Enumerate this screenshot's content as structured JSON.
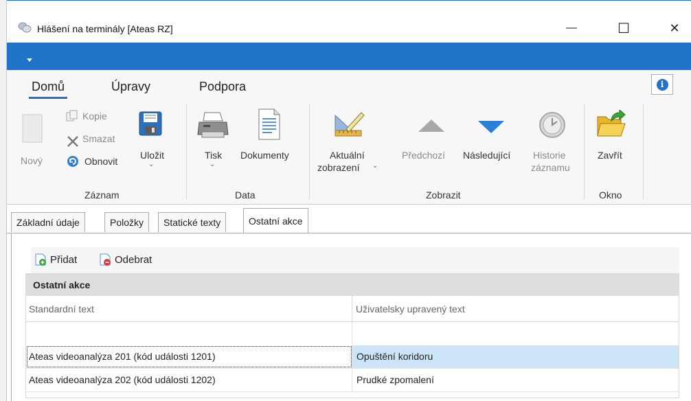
{
  "window": {
    "title": "Hlášení na terminály [Ateas RZ]",
    "min_glyph": "—",
    "max_glyph": "☐",
    "close_glyph": "✕"
  },
  "ribbon_tabs": [
    {
      "label": "Domů",
      "active": true
    },
    {
      "label": "Úpravy",
      "active": false
    },
    {
      "label": "Podpora",
      "active": false
    }
  ],
  "info_glyph": "i",
  "ribbon": {
    "groups": {
      "zaznam": "Záznam",
      "data": "Data",
      "zobrazit": "Zobrazit",
      "okno": "Okno"
    },
    "buttons": {
      "novy": "Nový",
      "kopie": "Kopie",
      "smazat": "Smazat",
      "obnovit": "Obnovit",
      "ulozit": "Uložit",
      "tisk": "Tisk",
      "dokumenty": "Dokumenty",
      "aktualni_1": "Aktuální",
      "aktualni_2": "zobrazení",
      "predchozi": "Předchozí",
      "nasledujici": "Následující",
      "historie_1": "Historie",
      "historie_2": "záznamu",
      "zavrit": "Zavřít"
    },
    "chevron": "⌄"
  },
  "doc_tabs": [
    {
      "label": "Základní údaje",
      "active": false
    },
    {
      "label": "Položky",
      "active": false
    },
    {
      "label": "Statické texty",
      "active": false
    },
    {
      "label": "Ostatní akce",
      "active": true
    }
  ],
  "toolbar": {
    "add_label": "Přidat",
    "remove_label": "Odebrat"
  },
  "grid": {
    "group_title": "Ostatní akce",
    "columns": [
      "Standardní text",
      "Uživatelsky upravený text"
    ],
    "rows": [
      {
        "standard": "Ateas videoanalýza 201 (kód události 1201)",
        "custom": "Opuštění koridoru",
        "selected": true
      },
      {
        "standard": "Ateas videoanalýza 202 (kód události 1202)",
        "custom": "Prudké zpomalení",
        "selected": false
      }
    ]
  },
  "colors": {
    "accent": "#1f73c8",
    "selection": "#cce5f6"
  }
}
